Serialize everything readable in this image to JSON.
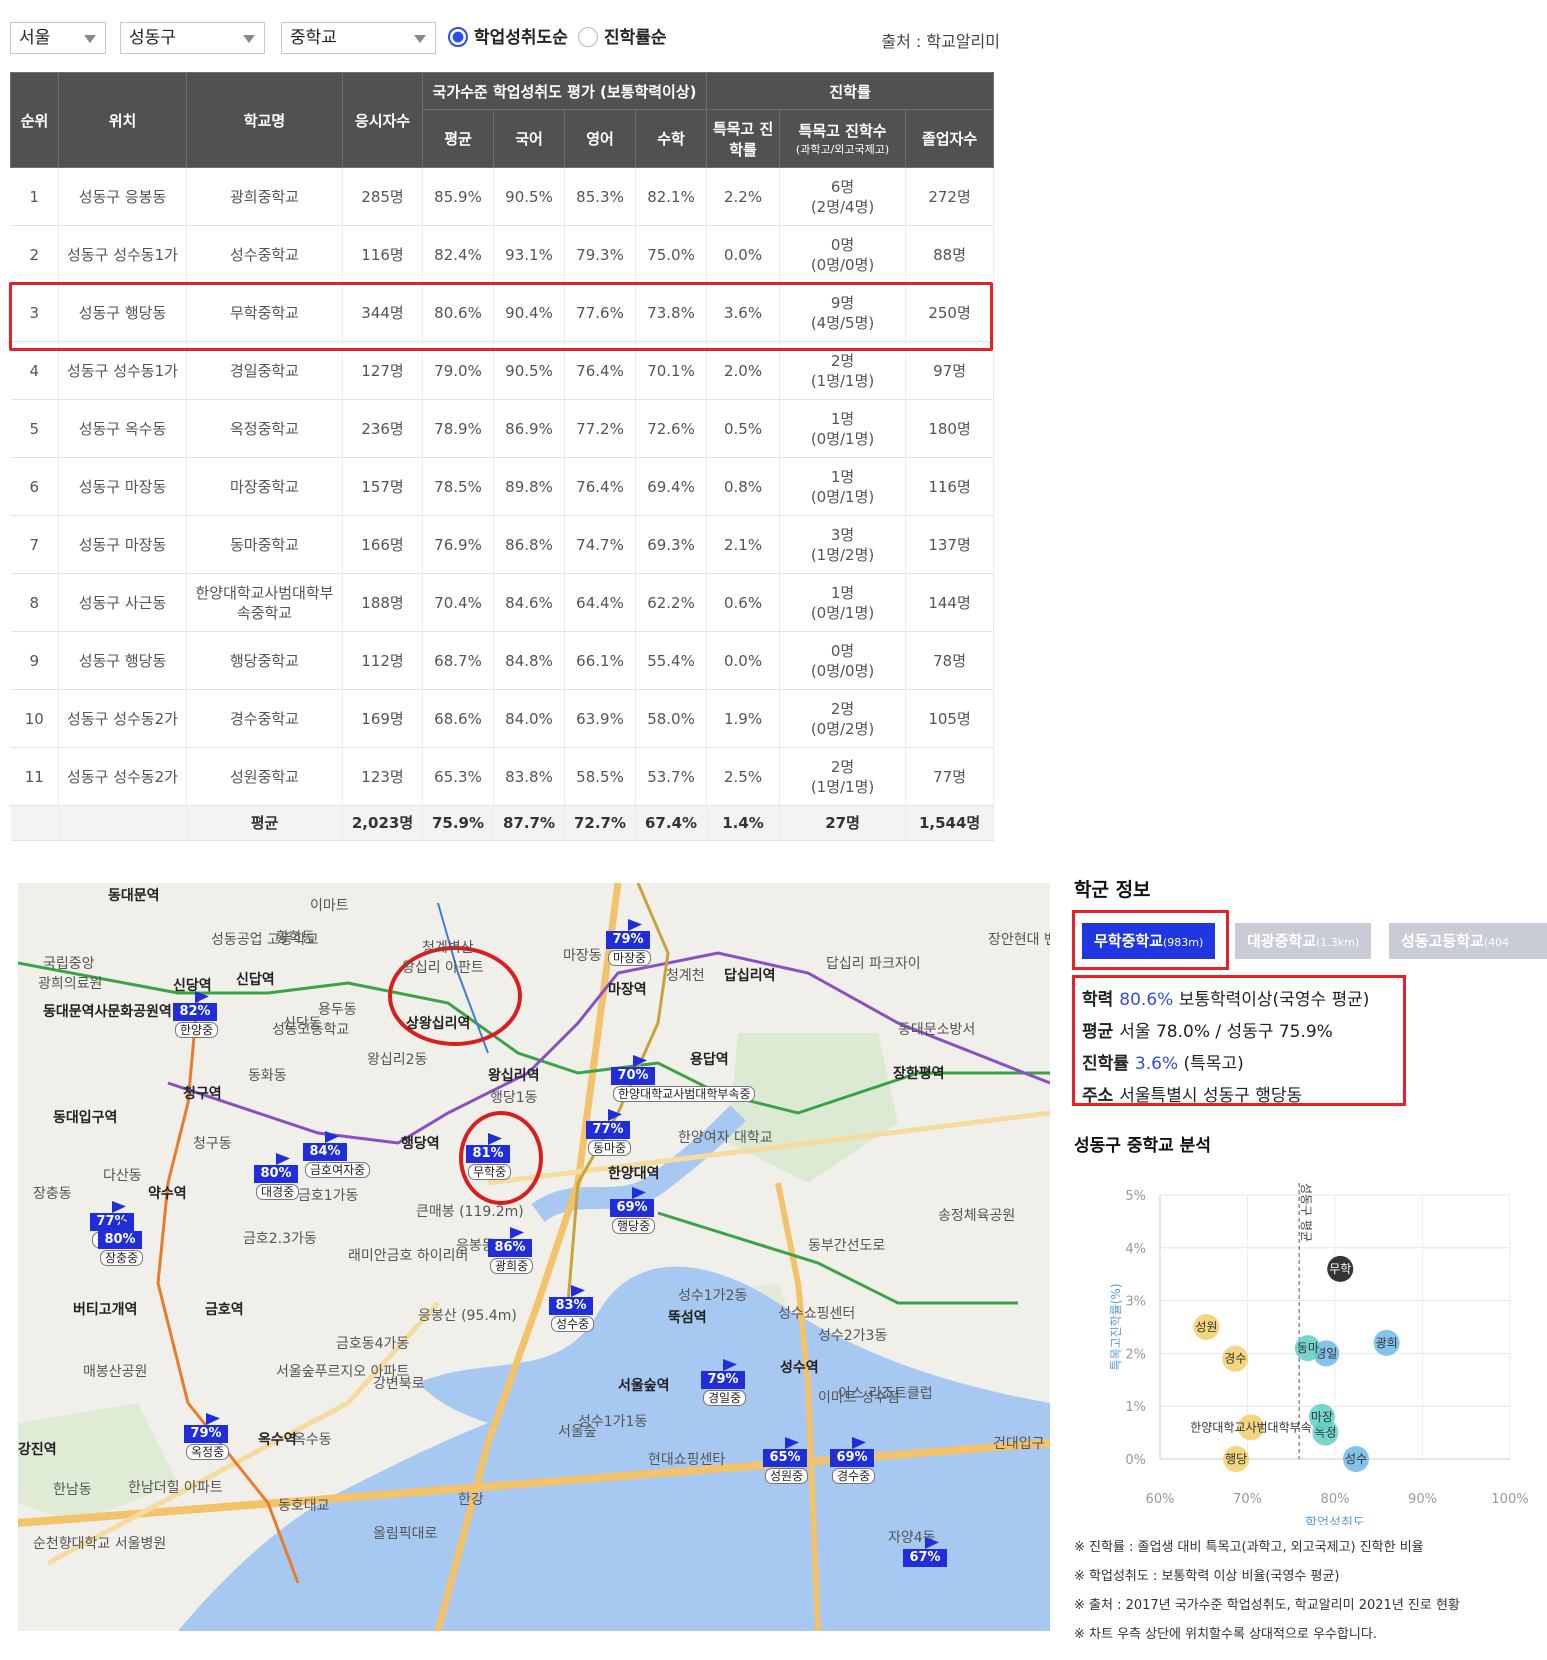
{
  "filters": {
    "region": "서울",
    "district": "성동구",
    "school_type": "중학교",
    "sort_options": [
      {
        "label": "학업성취도순",
        "selected": true
      },
      {
        "label": "진학률순",
        "selected": false
      }
    ],
    "source": "출처 : 학교알리미"
  },
  "table": {
    "header": {
      "rank": "순위",
      "location": "위치",
      "school": "학교명",
      "examinees": "응시자수",
      "achievement_group": "국가수준 학업성취도 평가 (보통학력이상)",
      "avg": "평균",
      "korean": "국어",
      "english": "영어",
      "math": "수학",
      "advance_group": "진학률",
      "special_rate": "특목고 진학률",
      "special_count": "특목고 진학수",
      "special_count_sub": "(과학고/외고국제고)",
      "graduates": "졸업자수"
    },
    "rows": [
      {
        "rank": "1",
        "loc": "성동구 응봉동",
        "school": "광희중학교",
        "n": "285명",
        "avg": "85.9%",
        "kor": "90.5%",
        "eng": "85.3%",
        "math": "82.1%",
        "rate": "2.2%",
        "cnt": "6명",
        "cnt_sub": "(2명/4명)",
        "grad": "272명"
      },
      {
        "rank": "2",
        "loc": "성동구 성수동1가",
        "school": "성수중학교",
        "n": "116명",
        "avg": "82.4%",
        "kor": "93.1%",
        "eng": "79.3%",
        "math": "75.0%",
        "rate": "0.0%",
        "cnt": "0명",
        "cnt_sub": "(0명/0명)",
        "grad": "88명"
      },
      {
        "rank": "3",
        "loc": "성동구 행당동",
        "school": "무학중학교",
        "n": "344명",
        "avg": "80.6%",
        "kor": "90.4%",
        "eng": "77.6%",
        "math": "73.8%",
        "rate": "3.6%",
        "cnt": "9명",
        "cnt_sub": "(4명/5명)",
        "grad": "250명"
      },
      {
        "rank": "4",
        "loc": "성동구 성수동1가",
        "school": "경일중학교",
        "n": "127명",
        "avg": "79.0%",
        "kor": "90.5%",
        "eng": "76.4%",
        "math": "70.1%",
        "rate": "2.0%",
        "cnt": "2명",
        "cnt_sub": "(1명/1명)",
        "grad": "97명"
      },
      {
        "rank": "5",
        "loc": "성동구 옥수동",
        "school": "옥정중학교",
        "n": "236명",
        "avg": "78.9%",
        "kor": "86.9%",
        "eng": "77.2%",
        "math": "72.6%",
        "rate": "0.5%",
        "cnt": "1명",
        "cnt_sub": "(0명/1명)",
        "grad": "180명"
      },
      {
        "rank": "6",
        "loc": "성동구 마장동",
        "school": "마장중학교",
        "n": "157명",
        "avg": "78.5%",
        "kor": "89.8%",
        "eng": "76.4%",
        "math": "69.4%",
        "rate": "0.8%",
        "cnt": "1명",
        "cnt_sub": "(0명/1명)",
        "grad": "116명"
      },
      {
        "rank": "7",
        "loc": "성동구 마장동",
        "school": "동마중학교",
        "n": "166명",
        "avg": "76.9%",
        "kor": "86.8%",
        "eng": "74.7%",
        "math": "69.3%",
        "rate": "2.1%",
        "cnt": "3명",
        "cnt_sub": "(1명/2명)",
        "grad": "137명"
      },
      {
        "rank": "8",
        "loc": "성동구 사근동",
        "school": "한양대학교사범대학부속중학교",
        "n": "188명",
        "avg": "70.4%",
        "kor": "84.6%",
        "eng": "64.4%",
        "math": "62.2%",
        "rate": "0.6%",
        "cnt": "1명",
        "cnt_sub": "(0명/1명)",
        "grad": "144명"
      },
      {
        "rank": "9",
        "loc": "성동구 행당동",
        "school": "행당중학교",
        "n": "112명",
        "avg": "68.7%",
        "kor": "84.8%",
        "eng": "66.1%",
        "math": "55.4%",
        "rate": "0.0%",
        "cnt": "0명",
        "cnt_sub": "(0명/0명)",
        "grad": "78명"
      },
      {
        "rank": "10",
        "loc": "성동구 성수동2가",
        "school": "경수중학교",
        "n": "169명",
        "avg": "68.6%",
        "kor": "84.0%",
        "eng": "63.9%",
        "math": "58.0%",
        "rate": "1.9%",
        "cnt": "2명",
        "cnt_sub": "(0명/2명)",
        "grad": "105명"
      },
      {
        "rank": "11",
        "loc": "성동구 성수동2가",
        "school": "성원중학교",
        "n": "123명",
        "avg": "65.3%",
        "kor": "83.8%",
        "eng": "58.5%",
        "math": "53.7%",
        "rate": "2.5%",
        "cnt": "2명",
        "cnt_sub": "(1명/1명)",
        "grad": "77명"
      }
    ],
    "average_row": {
      "label": "평균",
      "n": "2,023명",
      "avg": "75.9%",
      "kor": "87.7%",
      "eng": "72.7%",
      "math": "67.4%",
      "rate": "1.4%",
      "cnt": "27명",
      "grad": "1,544명"
    }
  },
  "map": {
    "places": [
      "동대문역",
      "이마트",
      "황학동",
      "청계벽산",
      "왕십리 아판트",
      "신당역",
      "신당동",
      "상왕십리역",
      "성동고등학교",
      "왕십리2동",
      "마장동",
      "마장역",
      "청계천",
      "답십리역",
      "답십리 파크자이",
      "동대문소방서",
      "장한평역",
      "용답역",
      "왕십리역",
      "행당1동",
      "동화동",
      "청구역",
      "동대입구역",
      "청구동",
      "행당역",
      "한양대역",
      "한양여자 대학교",
      "다산동",
      "약수역",
      "장충동",
      "금호1가동",
      "큰매봉 (119.2m)",
      "금호2.3가동",
      "래미안금호 하이리버",
      "응봉동",
      "금호역",
      "버티고개역",
      "매봉산공원",
      "응봉산 (95.4m)",
      "성수1가2동",
      "뚝섬역",
      "성수쇼핑센터",
      "성수2가3동",
      "성수역",
      "이마트 성수점",
      "서울숲역",
      "서울숲",
      "성수1가1동",
      "현대쇼핑센타",
      "서울숲푸르지오 아파트",
      "옥수역",
      "옥수동",
      "한남동",
      "한남더힐 아파트",
      "동호대교",
      "한강",
      "자양4동",
      "송정체육공원",
      "건대입구",
      "광희의료원",
      "국립중앙",
      "성동공업 고등학교",
      "동대문역사문화공원역",
      "강진역",
      "신답역",
      "용두동",
      "장안현대 벤처빌",
      "이스 리조트클럽",
      "순천향대학교 서울병원",
      "올림픽대로",
      "강변북로",
      "동부간선도로",
      "금호동4가동"
    ],
    "markers": [
      {
        "pct": "79%",
        "name": "마장중"
      },
      {
        "pct": "82%",
        "name": "한양중"
      },
      {
        "pct": "70%",
        "name": "한양대학교사범대학부속중"
      },
      {
        "pct": "77%",
        "name": "동마중"
      },
      {
        "pct": "84%",
        "name": "금호여자중"
      },
      {
        "pct": "80%",
        "name": "대경중"
      },
      {
        "pct": "81%",
        "name": "무학중"
      },
      {
        "pct": "69%",
        "name": "행당중"
      },
      {
        "pct": "77%",
        "name": "장충중"
      },
      {
        "pct": "80%",
        "name": "장충중"
      },
      {
        "pct": "86%",
        "name": "광희중"
      },
      {
        "pct": "83%",
        "name": "성수중"
      },
      {
        "pct": "79%",
        "name": "경일중"
      },
      {
        "pct": "79%",
        "name": "옥정중"
      },
      {
        "pct": "65%",
        "name": "성원중"
      },
      {
        "pct": "69%",
        "name": "경수중"
      },
      {
        "pct": "67%",
        "name": ""
      }
    ]
  },
  "info": {
    "title": "학군 정보",
    "tabs": [
      {
        "name": "무학중학교",
        "dist": "(983m)"
      },
      {
        "name": "대광중학교",
        "dist": "(1.3km)"
      },
      {
        "name": "성동고등학교",
        "dist": "(404"
      }
    ],
    "achievement_label": "학력",
    "achievement_value": "80.6%",
    "achievement_desc": "보통학력이상(국영수 평균)",
    "avg_label": "평균",
    "avg_value": "서울 78.0% / 성동구 75.9%",
    "advance_label": "진학률",
    "advance_value": "3.6%",
    "advance_desc": "(특목고)",
    "address_label": "주소",
    "address_value": "서울특별시 성동구 행당동",
    "analysis_title": "성동구 중학교 분석",
    "notes": [
      "※ 진학률 : 졸업생 대비 특목고(과학고, 외고국제고) 진학한 비율",
      "※ 학업성취도 : 보통학력 이상 비율(국영수 평균)",
      "※ 출처 : 2017년 국가수준 학업성취도, 학교알리미 2021년 진로 현황",
      "※ 차트 우측 상단에 위치할수록 상대적으로 우수합니다."
    ]
  },
  "chart_data": {
    "type": "scatter",
    "xlabel": "학업성취도",
    "ylabel": "특목고진학률(%)",
    "xlim": [
      60,
      100
    ],
    "ylim": [
      0,
      5
    ],
    "x_ticks": [
      "60%",
      "70%",
      "80%",
      "90%",
      "100%"
    ],
    "y_ticks": [
      "0%",
      "1%",
      "2%",
      "3%",
      "4%",
      "5%"
    ],
    "reference_line": {
      "x": 75.9,
      "label": "성동구 평균"
    },
    "points": [
      {
        "label": "무학",
        "x": 80.6,
        "y": 3.6,
        "color": "#111111"
      },
      {
        "label": "광희",
        "x": 85.9,
        "y": 2.2,
        "color": "#6fb9e6"
      },
      {
        "label": "성수",
        "x": 82.4,
        "y": 0.0,
        "color": "#6fb9e6"
      },
      {
        "label": "경일",
        "x": 79.0,
        "y": 2.0,
        "color": "#6fb9e6"
      },
      {
        "label": "동마",
        "x": 76.9,
        "y": 2.1,
        "color": "#5fd0c4"
      },
      {
        "label": "옥정",
        "x": 78.9,
        "y": 0.5,
        "color": "#5fd0c4"
      },
      {
        "label": "마장",
        "x": 78.5,
        "y": 0.8,
        "color": "#5fd0c4"
      },
      {
        "label": "성원",
        "x": 65.3,
        "y": 2.5,
        "color": "#f3cf6a"
      },
      {
        "label": "경수",
        "x": 68.6,
        "y": 1.9,
        "color": "#f3cf6a"
      },
      {
        "label": "한양대학교사범대학부속",
        "x": 70.4,
        "y": 0.6,
        "color": "#f3cf6a"
      },
      {
        "label": "행당",
        "x": 68.7,
        "y": 0.0,
        "color": "#f3cf6a"
      }
    ]
  }
}
